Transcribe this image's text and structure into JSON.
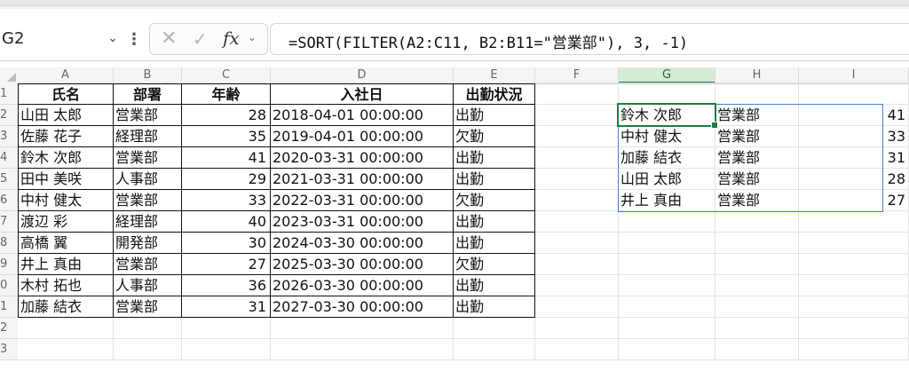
{
  "name_box": {
    "value": "G2"
  },
  "formula_bar": {
    "fx_label": "fx",
    "formula": "=SORT(FILTER(A2:C11, B2:B11=\"営業部\"), 3, -1)"
  },
  "icons": {
    "cancel": "✕",
    "confirm": "✓",
    "chevron": "⌄",
    "more": "⋮"
  },
  "columns": [
    "A",
    "B",
    "C",
    "D",
    "E",
    "F",
    "G",
    "H",
    "I"
  ],
  "rows": [
    "1",
    "2",
    "3",
    "4",
    "5",
    "6",
    "7",
    "8",
    "9",
    "0",
    "1",
    "2",
    "3"
  ],
  "table": {
    "headers": [
      "氏名",
      "部署",
      "年齢",
      "入社日",
      "出勤状況"
    ],
    "rows": [
      [
        "山田 太郎",
        "営業部",
        "28",
        "2018-04-01 00:00:00",
        "出勤"
      ],
      [
        "佐藤 花子",
        "経理部",
        "35",
        "2019-04-01 00:00:00",
        "欠勤"
      ],
      [
        "鈴木 次郎",
        "営業部",
        "41",
        "2020-03-31 00:00:00",
        "出勤"
      ],
      [
        "田中 美咲",
        "人事部",
        "29",
        "2021-03-31 00:00:00",
        "出勤"
      ],
      [
        "中村 健太",
        "営業部",
        "33",
        "2022-03-31 00:00:00",
        "欠勤"
      ],
      [
        "渡辺 彩",
        "経理部",
        "40",
        "2023-03-31 00:00:00",
        "出勤"
      ],
      [
        "高橋 翼",
        "開発部",
        "30",
        "2024-03-30 00:00:00",
        "出勤"
      ],
      [
        "井上 真由",
        "営業部",
        "27",
        "2025-03-30 00:00:00",
        "欠勤"
      ],
      [
        "木村 拓也",
        "人事部",
        "36",
        "2026-03-30 00:00:00",
        "出勤"
      ],
      [
        "加藤 結衣",
        "営業部",
        "31",
        "2027-03-30 00:00:00",
        "出勤"
      ]
    ]
  },
  "result": {
    "rows": [
      [
        "鈴木 次郎",
        "営業部",
        "41"
      ],
      [
        "中村 健太",
        "営業部",
        "33"
      ],
      [
        "加藤 結衣",
        "営業部",
        "31"
      ],
      [
        "山田 太郎",
        "営業部",
        "28"
      ],
      [
        "井上 真由",
        "営業部",
        "27"
      ]
    ]
  },
  "colors": {
    "selection_green": "#1e7b3e",
    "spill_border": "#4a7fd6",
    "header_bg": "#f5f5f5"
  }
}
